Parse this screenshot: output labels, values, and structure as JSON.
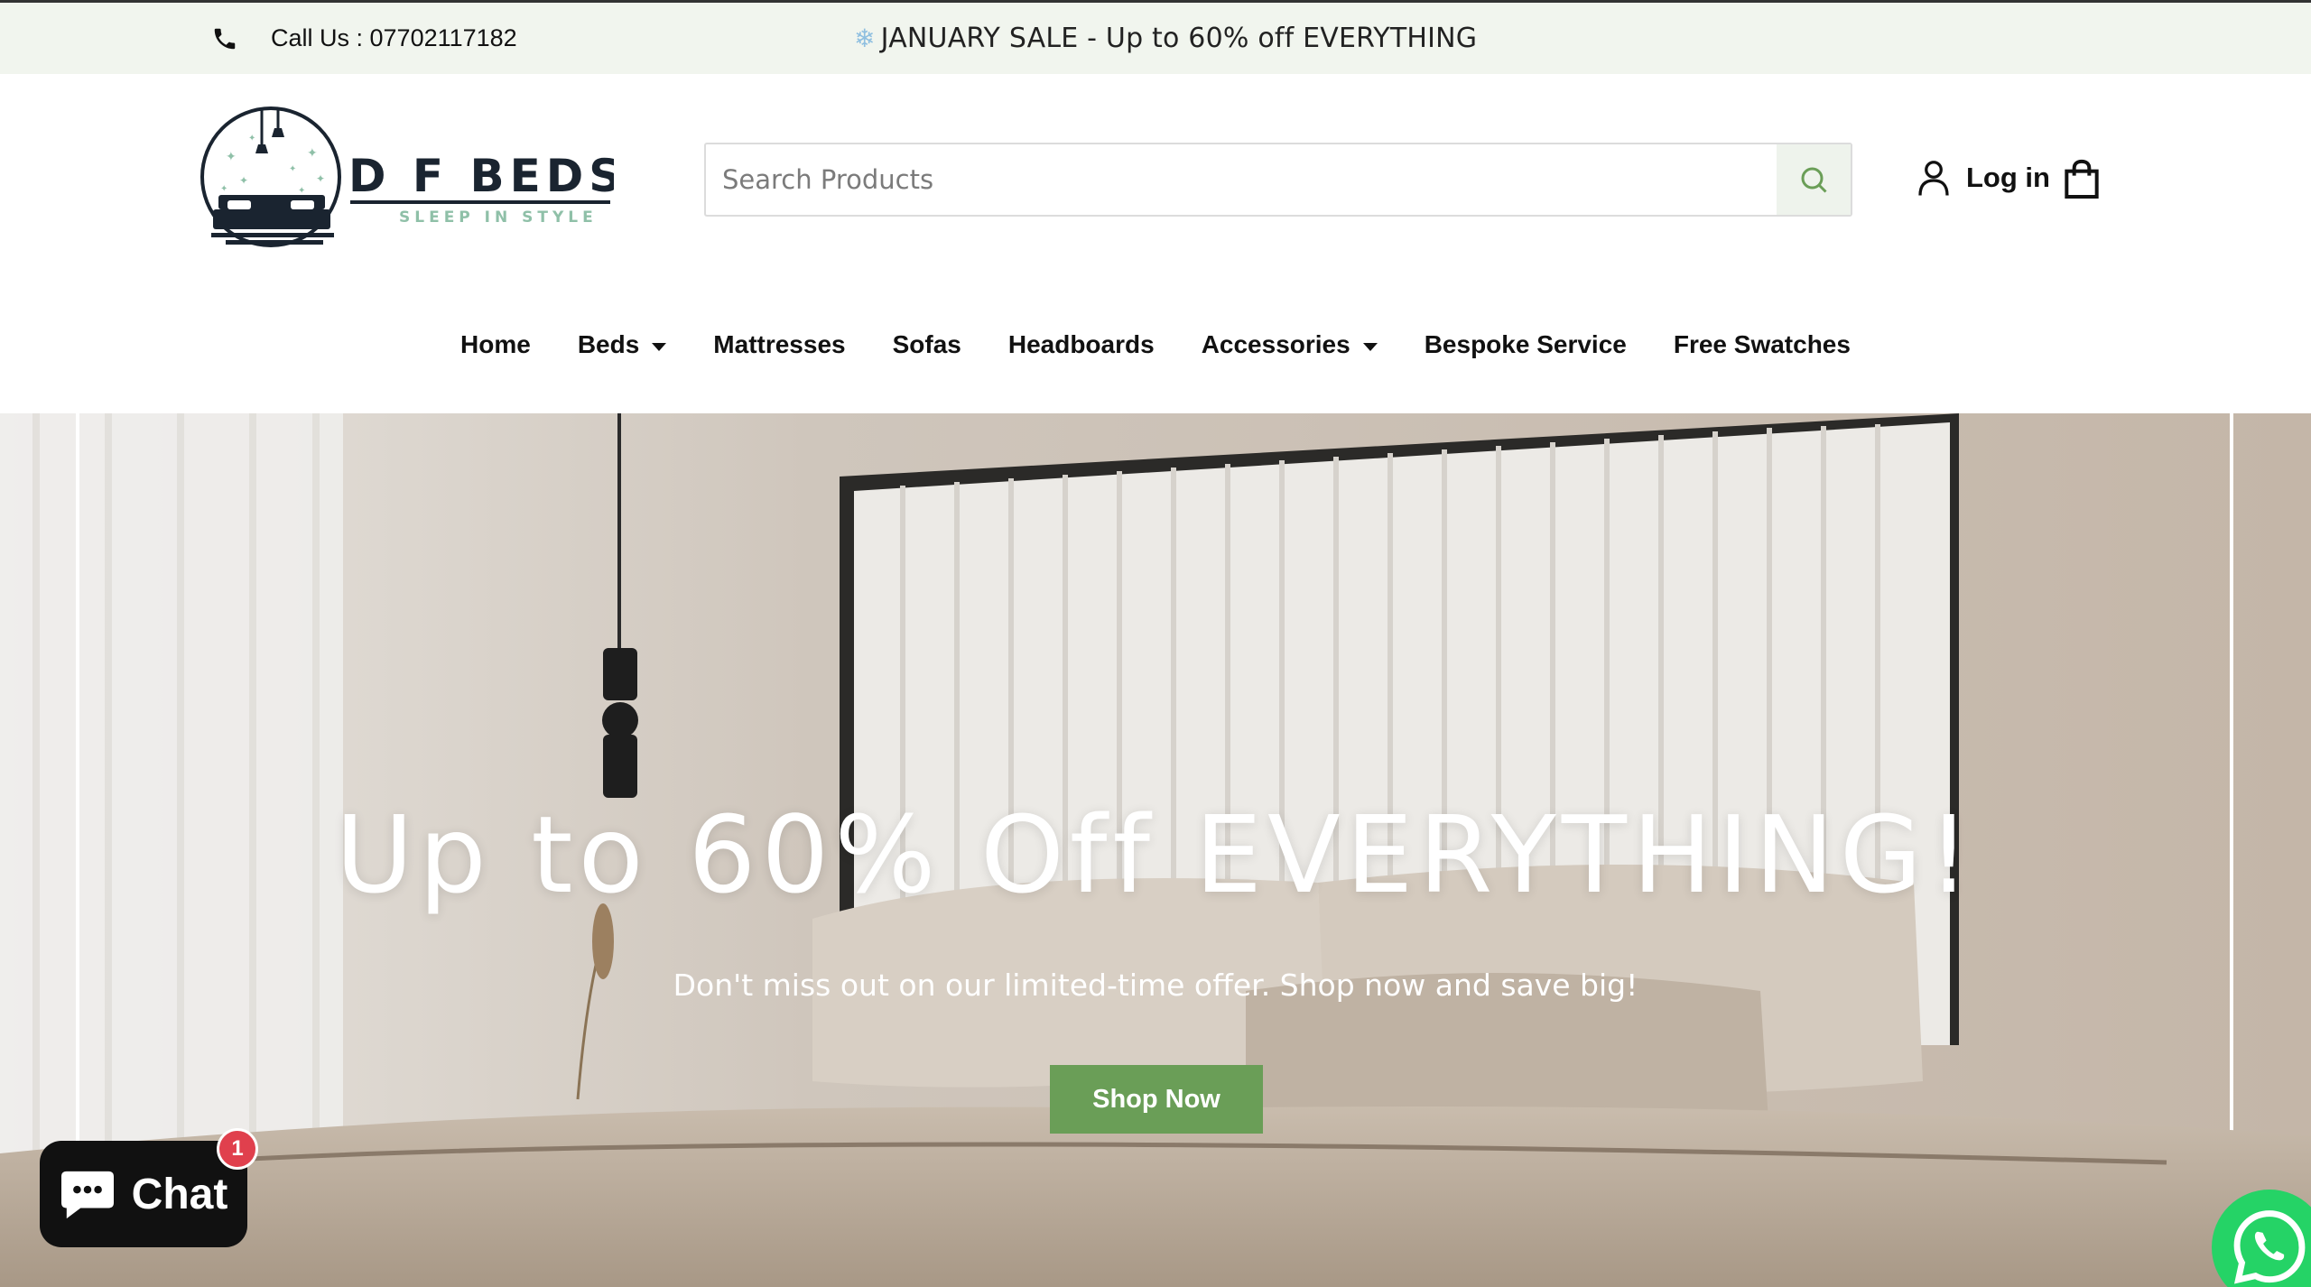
{
  "topbar": {
    "phone_text": "Call Us : 07702117182",
    "promo_text": "JANUARY SALE - Up to 60% off EVERYTHING",
    "promo_icon": "snowflake-icon"
  },
  "brand": {
    "name": "D F BEDS",
    "tagline": "SLEEP IN STYLE",
    "colors": {
      "dark": "#1a2430",
      "accent": "#8fc0a8"
    }
  },
  "search": {
    "placeholder": "Search Products",
    "button_icon": "search-icon"
  },
  "account": {
    "login_label": "Log in",
    "cart_icon": "shopping-bag-icon"
  },
  "nav": {
    "items": [
      {
        "label": "Home",
        "dropdown": false
      },
      {
        "label": "Beds",
        "dropdown": true
      },
      {
        "label": "Mattresses",
        "dropdown": false
      },
      {
        "label": "Sofas",
        "dropdown": false
      },
      {
        "label": "Headboards",
        "dropdown": false
      },
      {
        "label": "Accessories",
        "dropdown": true
      },
      {
        "label": "Bespoke Service",
        "dropdown": false
      },
      {
        "label": "Free Swatches",
        "dropdown": false
      }
    ]
  },
  "hero": {
    "heading": "Up to 60% Off EVERYTHING!",
    "subheading": "Don't miss out on our limited-time offer. Shop now and save big!",
    "cta_label": "Shop Now",
    "cta_color": "#6a9e57"
  },
  "chat": {
    "label": "Chat",
    "badge_count": "1"
  },
  "whatsapp": {
    "icon": "whatsapp-icon"
  }
}
